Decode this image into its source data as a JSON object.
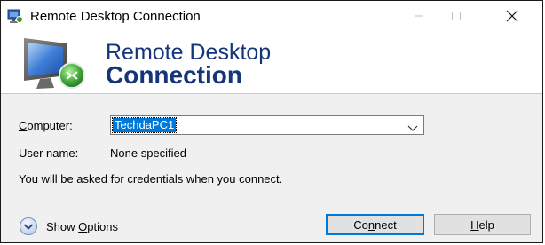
{
  "window": {
    "title": "Remote Desktop Connection"
  },
  "banner": {
    "line1": "Remote Desktop",
    "line2": "Connection"
  },
  "form": {
    "computer_label_prefix": "",
    "computer_label_mnemonic": "C",
    "computer_label_rest": "omputer:",
    "computer_value": "TechdaPC1",
    "user_label": "User name:",
    "user_value": "None specified",
    "note": "You will be asked for credentials when you connect."
  },
  "footer": {
    "options_prefix": "Show ",
    "options_mnemonic": "O",
    "options_rest": "ptions",
    "connect_prefix": "Co",
    "connect_mnemonic": "n",
    "connect_rest": "nect",
    "help_mnemonic": "H",
    "help_rest": "elp"
  },
  "colors": {
    "brand": "#14357a",
    "selection": "#0078d7",
    "focus_border": "#0078d7"
  },
  "icons": {
    "title": "rdc-app-icon",
    "banner": "rdc-monitor-logo",
    "options": "chevron-down-circle-icon"
  }
}
